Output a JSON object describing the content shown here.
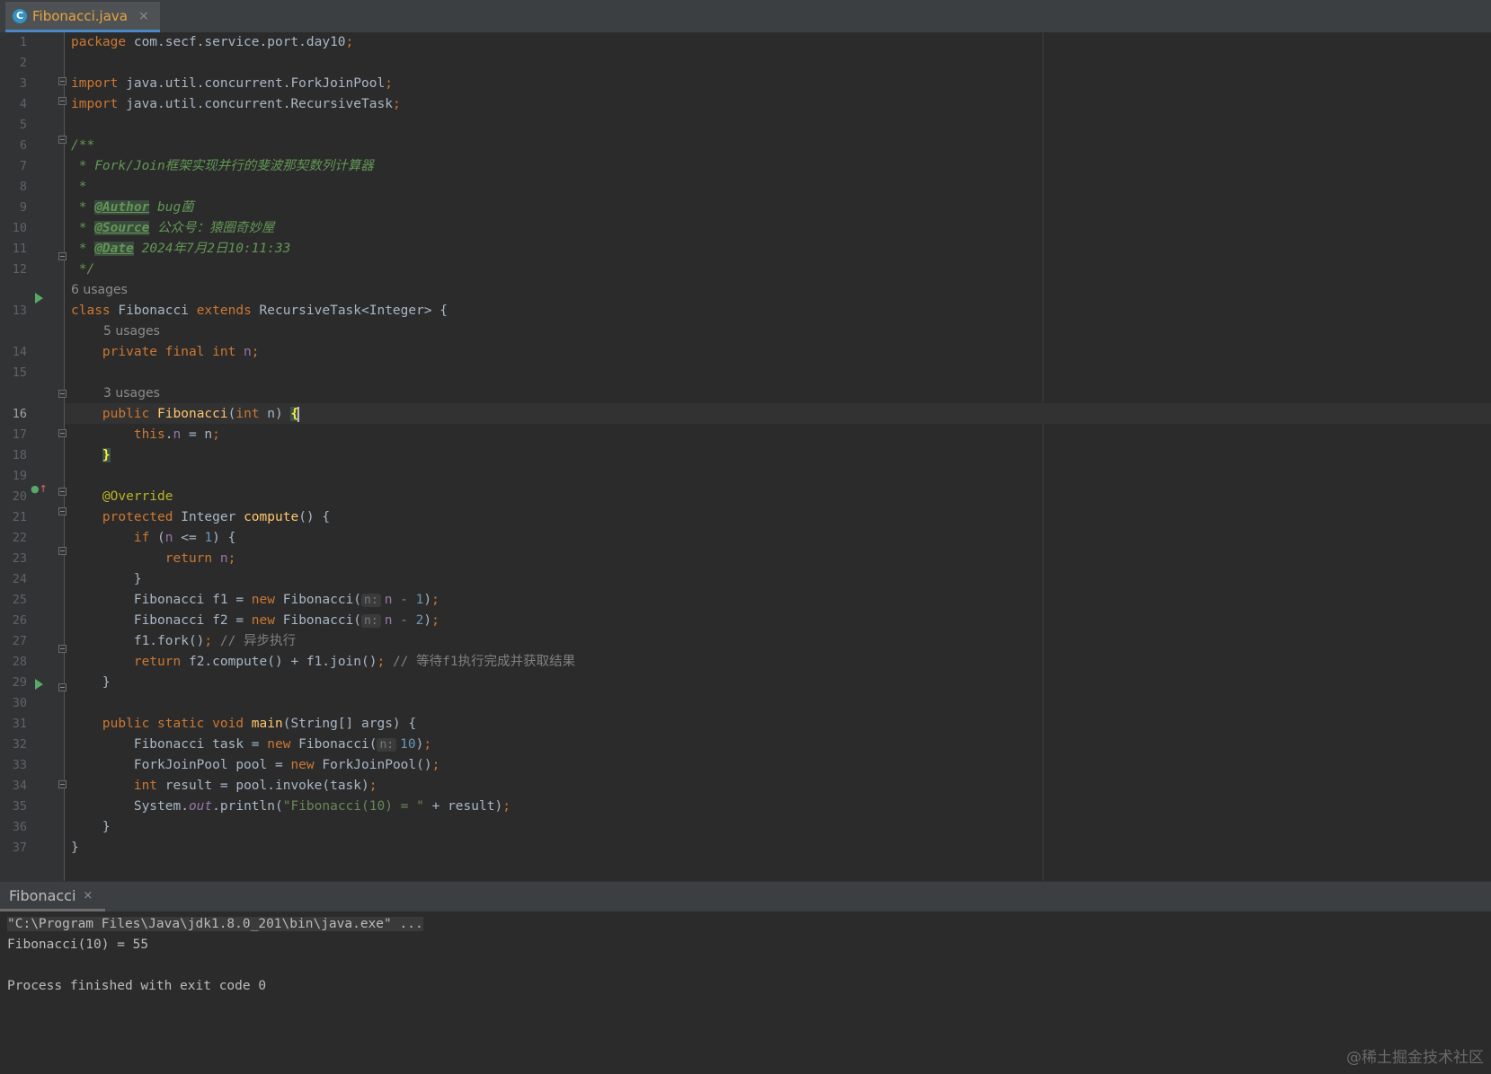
{
  "tab": {
    "icon_letter": "C",
    "filename": "Fibonacci.java",
    "close": "×"
  },
  "editor": {
    "lines": {
      "l1": {
        "no": "1",
        "pkg_kw": "package",
        "pkg": " com.secf.service.port.day10",
        "semi": ";"
      },
      "l2": {
        "no": "2"
      },
      "l3": {
        "no": "3",
        "kw": "import",
        "rest": " java.util.concurrent.ForkJoinPool",
        "semi": ";"
      },
      "l4": {
        "no": "4",
        "kw": "import",
        "rest": " java.util.concurrent.RecursiveTask",
        "semi": ";"
      },
      "l5": {
        "no": "5"
      },
      "l6": {
        "no": "6",
        "text": "/**"
      },
      "l7": {
        "no": "7",
        "text": " * Fork/Join框架实现并行的斐波那契数列计算器"
      },
      "l8": {
        "no": "8",
        "text": " *"
      },
      "l9": {
        "no": "9",
        "prefix": " * ",
        "tag": "@Author",
        "value": " bug菌"
      },
      "l10": {
        "no": "10",
        "prefix": " * ",
        "tag": "@Source",
        "value": " 公众号：猿圈奇妙屋"
      },
      "l11": {
        "no": "11",
        "prefix": " * ",
        "tag": "@Date",
        "value": " 2024年7月2日10:11:33"
      },
      "l12": {
        "no": "12",
        "text": " */"
      },
      "l13": {
        "no": "13",
        "kw1": "class",
        "name": " Fibonacci ",
        "kw2": "extends",
        "rest": " RecursiveTask<Integer> {"
      },
      "l14": {
        "no": "14",
        "kw": "private final int",
        "field": " n",
        "semi": ";"
      },
      "l15": {
        "no": "15"
      },
      "l16": {
        "no": "16",
        "kw": "public",
        "fn": " Fibonacci",
        "p1": "(",
        "kw2": "int",
        "p2": " n) ",
        "brace": "{"
      },
      "l17": {
        "no": "17",
        "kw": "this",
        "dot": ".",
        "field": "n",
        "rest": " = n",
        "semi": ";"
      },
      "l18": {
        "no": "18",
        "brace": "}"
      },
      "l19": {
        "no": "19"
      },
      "l20": {
        "no": "20",
        "ann": "@Override"
      },
      "l21": {
        "no": "21",
        "kw": "protected",
        "type": " Integer ",
        "fn": "compute",
        "rest": "() {"
      },
      "l22": {
        "no": "22",
        "kw": "if",
        "p1": " (",
        "field": "n",
        "p2": " <= ",
        "num": "1",
        "p3": ") {"
      },
      "l23": {
        "no": "23",
        "kw": "return",
        "field": " n",
        "semi": ";"
      },
      "l24": {
        "no": "24",
        "text": "}"
      },
      "l25": {
        "no": "25",
        "a": "Fibonacci f1 = ",
        "kw": "new",
        "b": " Fibonacci(",
        "hint": "n:",
        "c": "n - ",
        "num": "1",
        "d": ")",
        "semi": ";"
      },
      "l26": {
        "no": "26",
        "a": "Fibonacci f2 = ",
        "kw": "new",
        "b": " Fibonacci(",
        "hint": "n:",
        "c": "n - ",
        "num": "2",
        "d": ")",
        "semi": ";"
      },
      "l27": {
        "no": "27",
        "a": "f1.fork()",
        "semi": ";",
        "comment": " // 异步执行"
      },
      "l28": {
        "no": "28",
        "kw": "return",
        "a": " f2.compute() + f1.join()",
        "semi": ";",
        "comment": " // 等待f1执行完成并获取结果"
      },
      "l29": {
        "no": "29",
        "text": "}"
      },
      "l30": {
        "no": "30"
      },
      "l31": {
        "no": "31",
        "kw": "public static void",
        "fn": " main",
        "rest": "(String[] args) {"
      },
      "l32": {
        "no": "32",
        "a": "Fibonacci task = ",
        "kw": "new",
        "b": " Fibonacci(",
        "hint": "n:",
        "num": "10",
        "d": ")",
        "semi": ";"
      },
      "l33": {
        "no": "33",
        "a": "ForkJoinPool pool = ",
        "kw": "new",
        "b": " ForkJoinPool()",
        "semi": ";"
      },
      "l34": {
        "no": "34",
        "kw": "int",
        "a": " result = pool.invoke(task)",
        "semi": ";"
      },
      "l35": {
        "no": "35",
        "a": "System.",
        "out": "out",
        "b": ".println(",
        "str": "\"Fibonacci(10) = \"",
        "c": " + result)",
        "semi": ";"
      },
      "l36": {
        "no": "36",
        "text": "}"
      },
      "l37": {
        "no": "37",
        "text": "}"
      }
    },
    "usages": {
      "class": "6 usages",
      "field": "5 usages",
      "ctor": "3 usages"
    }
  },
  "run": {
    "tab_label": "Fibonacci",
    "close": "×",
    "command": "\"C:\\Program Files\\Java\\jdk1.8.0_201\\bin\\java.exe\" ...",
    "output": "Fibonacci(10) = 55",
    "exit": "Process finished with exit code 0"
  },
  "watermark": "@稀土掘金技术社区"
}
